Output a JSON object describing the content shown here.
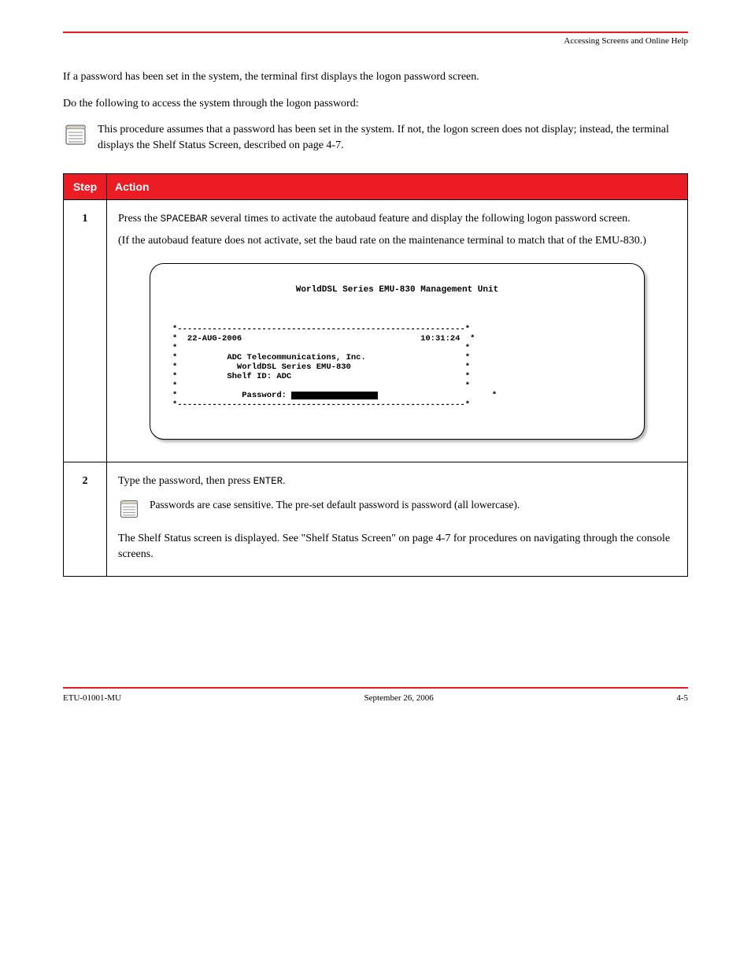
{
  "header": {
    "right": "Accessing Screens and Online Help"
  },
  "intro": {
    "line1": "If a password has been set in the system, the terminal first displays the logon password screen.",
    "line2": "Do the following to access the system through the logon password:"
  },
  "note_top": "This procedure assumes that a password has been set in the system. If not, the logon screen does not display; instead, the terminal displays the Shelf Status Screen, described on page 4-7.",
  "table": {
    "head_step": "Step",
    "head_action": "Action",
    "rows": [
      {
        "num": "1",
        "para1_a": "Press the ",
        "para1_b": "SPACEBAR",
        "para1_c": " several times to activate the autobaud feature and display the following logon password screen.",
        "para2": "(If the autobaud feature does not activate, set the baud rate on the maintenance terminal to match that of the EMU-830.)",
        "term": {
          "title": "WorldDSL Series EMU-830 Management Unit",
          "date": "22-AUG-2006",
          "time": "10:31:24",
          "l1": "ADC Telecommunications, Inc.",
          "l2": "WorldDSL Series EMU-830",
          "l3": "Shelf ID: ADC",
          "pw_label": "Password:"
        }
      },
      {
        "num": "2",
        "pre": "Type the password, then press ",
        "enter": "ENTER",
        "post": "",
        "note": "Passwords are case sensitive. The pre-set default password is password (all lowercase).",
        "after": "The Shelf Status screen is displayed. See \"Shelf Status Screen\" on page 4-7 for procedures on navigating through the console screens."
      }
    ]
  },
  "footer": {
    "left": "ETU-01001-MU",
    "center": "September 26, 2006",
    "right": "4-5"
  }
}
